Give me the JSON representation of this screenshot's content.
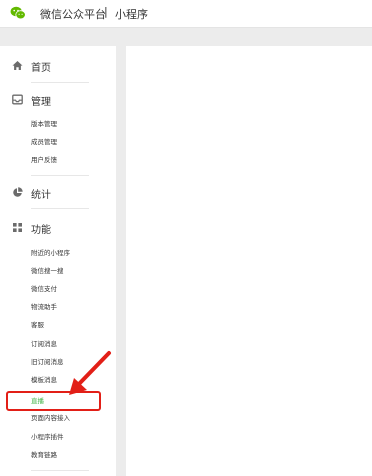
{
  "header": {
    "brand": "微信公众平台",
    "separator": "|",
    "product": "小程序"
  },
  "sidebar": {
    "home": {
      "label": "首页",
      "icon": "home-icon"
    },
    "manage": {
      "label": "管理",
      "icon": "inbox-icon",
      "items": [
        "版本管理",
        "成员管理",
        "用户反馈"
      ]
    },
    "stats": {
      "label": "统计",
      "icon": "pie-chart-icon"
    },
    "features": {
      "label": "功能",
      "icon": "grid-icon",
      "items": [
        "附近的小程序",
        "微信搜一搜",
        "微信支付",
        "物流助手",
        "客服",
        "订阅消息",
        "旧订阅消息",
        "模板消息",
        "直播",
        "页面内容接入",
        "小程序插件",
        "教育链路"
      ],
      "active_item": "直播"
    }
  },
  "colors": {
    "accent_green": "#44b549",
    "annotation_red": "#e21f17",
    "background": "#ececec"
  }
}
